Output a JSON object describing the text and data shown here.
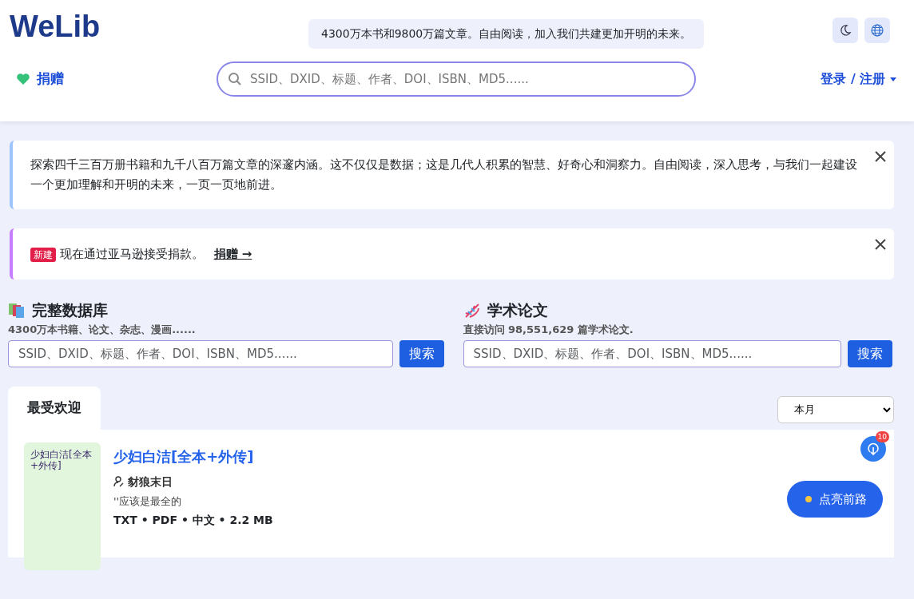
{
  "header": {
    "logo": "WeLib",
    "tagline": "4300万本书和9800万篇文章。自由阅读，加入我们共建更加开明的未来。",
    "donate": "捐赠",
    "search": {
      "placeholder": "SSID、DXID、标题、作者、DOI、ISBN、MD5......"
    },
    "login": "登录 / 注册"
  },
  "alerts": [
    {
      "kind": "info",
      "text": "探索四千三百万册书籍和九千八百万篇文章的深邃内涵。这不仅仅是数据；这是几代人积累的智慧、好奇心和洞察力。自由阅读，深入思考，与我们一起建设一个更加理解和开明的未来，一页一页地前进。",
      "color": "#9ec5fe"
    },
    {
      "kind": "promo",
      "badge": "新建",
      "text": "现在通过亚马逊接受捐款。",
      "link": "捐赠 →",
      "color": "#c77dff"
    }
  ],
  "search_panels": [
    {
      "kind": "books",
      "title": "完整数据库",
      "subtitle": "4300万本书籍、论文、杂志、漫画......",
      "placeholder": "SSID、DXID、标题、作者、DOI、ISBN、MD5......",
      "button": "搜索"
    },
    {
      "kind": "papers",
      "title": "学术论文",
      "subtitle": "直接访问 98,551,629 篇学术论文.",
      "placeholder": "SSID、DXID、标题、作者、DOI、ISBN、MD5......",
      "button": "搜索"
    }
  ],
  "popular": {
    "tab": "最受欢迎",
    "period": "本月",
    "notification_count": "10",
    "books": [
      {
        "cover_title": "少妇白洁[全本+外传]",
        "title": "少妇白洁[全本+外传]",
        "author": "豺狼末日",
        "description": "''应该是最全的",
        "meta": "TXT • PDF • 中文 • 2.2 MB"
      }
    ],
    "cta": "点亮前路"
  }
}
